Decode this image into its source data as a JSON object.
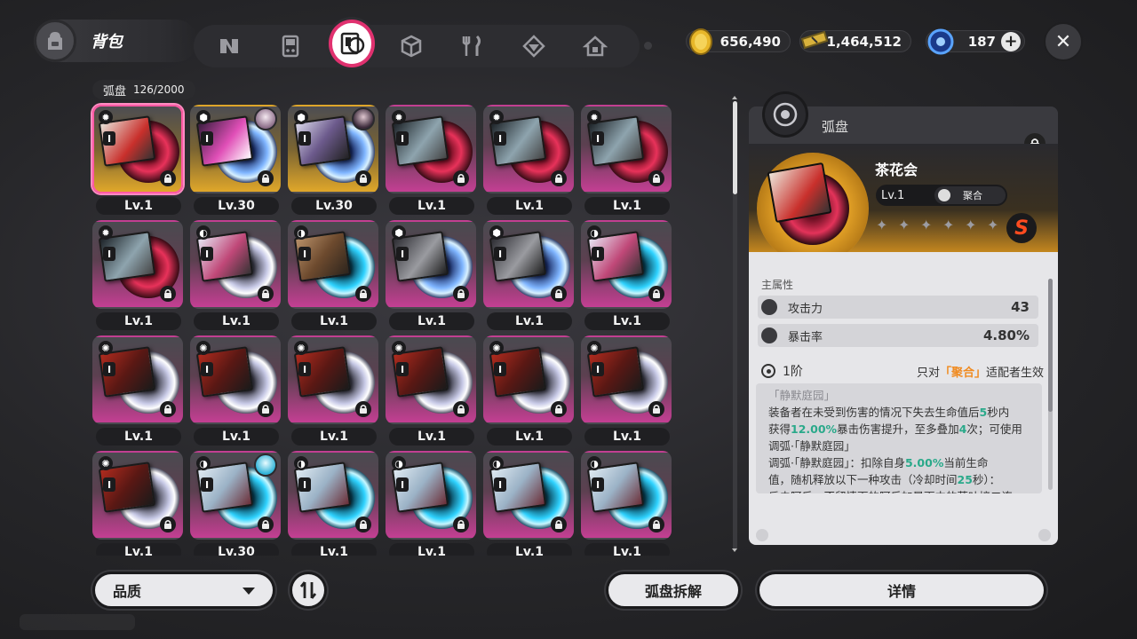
{
  "header": {
    "title": "背包",
    "tabs": [
      "agents-tab",
      "bangboo-tab",
      "drive-discs-tab",
      "materials-tab",
      "food-tab",
      "w-engines-tab",
      "home-tab"
    ],
    "active_tab": "drive-discs-tab"
  },
  "currencies": [
    {
      "icon": "dennies-coin-icon",
      "value": "656,490"
    },
    {
      "icon": "ticket-icon",
      "value": "1,464,512"
    },
    {
      "icon": "polychrome-icon",
      "value": "187"
    }
  ],
  "inventory": {
    "label": "弧盘",
    "count": "126/2000",
    "items": [
      {
        "level": "Lv.1",
        "rank": "I",
        "type": "gear",
        "tile": "pink",
        "disc": "red",
        "cover": "c1",
        "selected": true,
        "tile_override": "gold"
      },
      {
        "level": "Lv.30",
        "rank": "I",
        "type": "dice",
        "tile": "gold",
        "disc": "blue",
        "cover": "c2",
        "avatar": "normal"
      },
      {
        "level": "Lv.30",
        "rank": "I",
        "type": "dice",
        "tile": "gold",
        "disc": "blue",
        "cover": "c3",
        "avatar": "dark"
      },
      {
        "level": "Lv.1",
        "rank": "I",
        "type": "gear",
        "tile": "pink",
        "disc": "red",
        "cover": "c4"
      },
      {
        "level": "Lv.1",
        "rank": "I",
        "type": "gear",
        "tile": "pink",
        "disc": "red",
        "cover": "c4"
      },
      {
        "level": "Lv.1",
        "rank": "I",
        "type": "gear",
        "tile": "pink",
        "disc": "red",
        "cover": "c4"
      },
      {
        "level": "Lv.1",
        "rank": "I",
        "type": "gear",
        "tile": "pink",
        "disc": "red",
        "cover": "c4"
      },
      {
        "level": "Lv.1",
        "rank": "I",
        "type": "swirl",
        "tile": "pink",
        "disc": "white",
        "cover": "c7"
      },
      {
        "level": "Lv.1",
        "rank": "I",
        "type": "wave",
        "tile": "pink",
        "disc": "cyan",
        "cover": "c5"
      },
      {
        "level": "Lv.1",
        "rank": "I",
        "type": "dice",
        "tile": "pink",
        "disc": "blue",
        "cover": "c6"
      },
      {
        "level": "Lv.1",
        "rank": "I",
        "type": "dice",
        "tile": "pink",
        "disc": "blue",
        "cover": "c6"
      },
      {
        "level": "Lv.1",
        "rank": "I",
        "type": "wave",
        "tile": "pink",
        "disc": "cyan",
        "cover": "c7"
      },
      {
        "level": "Lv.1",
        "rank": "I",
        "type": "spiral",
        "tile": "pink",
        "disc": "white",
        "cover": "c8"
      },
      {
        "level": "Lv.1",
        "rank": "I",
        "type": "spiral",
        "tile": "pink",
        "disc": "white",
        "cover": "c8"
      },
      {
        "level": "Lv.1",
        "rank": "I",
        "type": "spiral",
        "tile": "pink",
        "disc": "white",
        "cover": "c8"
      },
      {
        "level": "Lv.1",
        "rank": "I",
        "type": "spiral",
        "tile": "pink",
        "disc": "white",
        "cover": "c8"
      },
      {
        "level": "Lv.1",
        "rank": "I",
        "type": "spiral",
        "tile": "pink",
        "disc": "white",
        "cover": "c8"
      },
      {
        "level": "Lv.1",
        "rank": "I",
        "type": "spiral",
        "tile": "pink",
        "disc": "white",
        "cover": "c8"
      },
      {
        "level": "Lv.1",
        "rank": "I",
        "type": "spiral",
        "tile": "pink",
        "disc": "white",
        "cover": "c8"
      },
      {
        "level": "Lv.30",
        "rank": "I",
        "type": "wave",
        "tile": "pink",
        "disc": "cyan",
        "cover": "c9",
        "avatar": "cyan"
      },
      {
        "level": "Lv.1",
        "rank": "I",
        "type": "wave",
        "tile": "pink",
        "disc": "cyan",
        "cover": "c9"
      },
      {
        "level": "Lv.1",
        "rank": "I",
        "type": "wave",
        "tile": "pink",
        "disc": "cyan",
        "cover": "c9"
      },
      {
        "level": "Lv.1",
        "rank": "I",
        "type": "wave",
        "tile": "pink",
        "disc": "cyan",
        "cover": "c9"
      },
      {
        "level": "Lv.1",
        "rank": "I",
        "type": "wave",
        "tile": "pink",
        "disc": "cyan",
        "cover": "c9"
      }
    ]
  },
  "bottom": {
    "sort_label": "品质",
    "dismantle_label": "弧盘拆解",
    "details_label": "详情"
  },
  "detail": {
    "header": "弧盘",
    "name": "茶花会",
    "level": "Lv.1",
    "attribute": "聚合",
    "rank": "S",
    "stars": [
      "✦",
      "✦",
      "✦",
      "✦",
      "✦",
      "✦",
      "✦"
    ],
    "main_stats_label": "主属性",
    "stats": [
      {
        "name": "攻击力",
        "value": "43",
        "icon": "attack-icon"
      },
      {
        "name": "暴击率",
        "value": "4.80%",
        "icon": "crit-rate-icon"
      }
    ],
    "tier": "1阶",
    "condition_prefix": "只对",
    "condition_highlight": "「聚合」",
    "condition_suffix": "适配者生效",
    "effect_title": "「静默庭园」",
    "effect_lines": [
      [
        "装备者在未受到伤害的情况下失去生命值后",
        "5",
        "秒内"
      ],
      [
        "获得",
        "12.00%",
        "暴击伤害提升，至多叠加",
        "4",
        "次；可使用"
      ],
      [
        "调弧·「静默庭园」"
      ],
      [
        "调弧·「静默庭园」：扣除自身",
        "5.00%",
        "当前生命"
      ],
      [
        "值，随机释放以下一种攻击（冷却时间",
        "25",
        "秒）："
      ],
      [
        "反击阿斥：不留情面的阿斥加暴雨中的落叶接二连"
      ]
    ]
  }
}
